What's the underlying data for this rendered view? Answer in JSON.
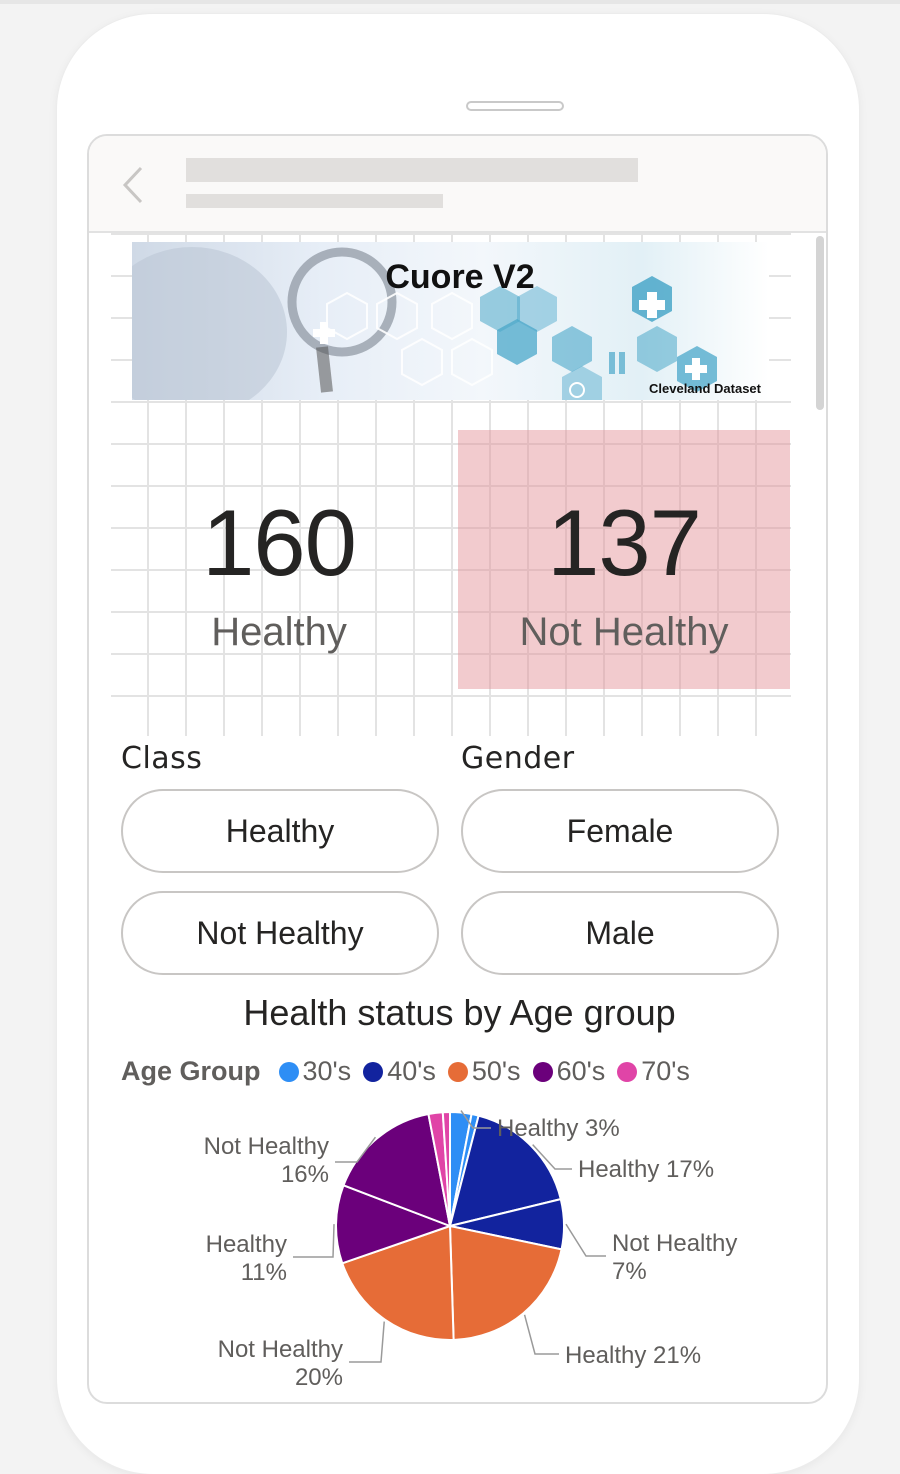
{
  "banner": {
    "title": "Cuore V2",
    "subtitle": "Cleveland Dataset"
  },
  "kpis": {
    "healthy": {
      "value": "160",
      "label": "Healthy"
    },
    "not_healthy": {
      "value": "137",
      "label": "Not Healthy"
    }
  },
  "slicers": {
    "class": {
      "title": "Class",
      "options": [
        "Healthy",
        "Not Healthy"
      ]
    },
    "gender": {
      "title": "Gender",
      "options": [
        "Female",
        "Male"
      ]
    }
  },
  "colors": {
    "highlight": "#f0c8cb",
    "30s": "#2e8ef5",
    "40s": "#12239e",
    "50s": "#e66c37",
    "60s": "#6b007b",
    "70s": "#e044a7"
  },
  "chart": {
    "title": "Health status by Age group",
    "legend_title": "Age Group",
    "legend": [
      "30's",
      "40's",
      "50's",
      "60's",
      "70's"
    ]
  },
  "chart_data": {
    "type": "pie",
    "title": "Health status by Age group",
    "legend_title": "Age Group",
    "legend_placement": "top-left",
    "slices": [
      {
        "group": "30's",
        "status": "Healthy",
        "percent": 3,
        "label": "Healthy 3%"
      },
      {
        "group": "30's",
        "status": "Not Healthy",
        "percent": 1,
        "label": ""
      },
      {
        "group": "40's",
        "status": "Healthy",
        "percent": 17,
        "label": "Healthy 17%"
      },
      {
        "group": "40's",
        "status": "Not Healthy",
        "percent": 7,
        "label": "Not Healthy 7%"
      },
      {
        "group": "50's",
        "status": "Healthy",
        "percent": 21,
        "label": "Healthy 21%"
      },
      {
        "group": "50's",
        "status": "Not Healthy",
        "percent": 20,
        "label": "Not Healthy 20%"
      },
      {
        "group": "60's",
        "status": "Healthy",
        "percent": 11,
        "label": "Healthy 11%"
      },
      {
        "group": "60's",
        "status": "Not Healthy",
        "percent": 16,
        "label": "Not Healthy 16%"
      },
      {
        "group": "70's",
        "status": "Healthy",
        "percent": 2,
        "label": ""
      },
      {
        "group": "70's",
        "status": "Not Healthy",
        "percent": 1,
        "label": ""
      }
    ]
  }
}
